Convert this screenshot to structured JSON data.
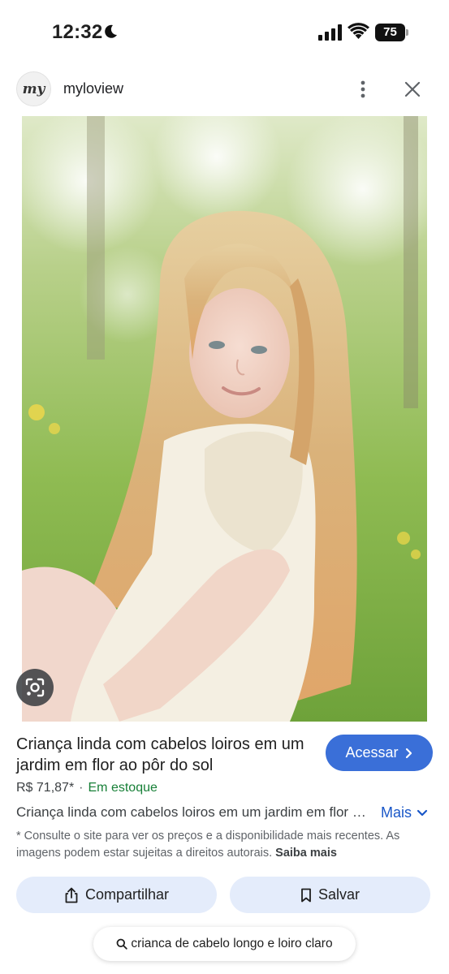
{
  "status_bar": {
    "time": "12:32",
    "battery": "75",
    "icons": [
      "moon-icon",
      "signal-icon",
      "wifi-icon",
      "battery-icon"
    ]
  },
  "header": {
    "site_avatar_text": "my",
    "site_name": "myloview",
    "icons": [
      "more-vert-icon",
      "close-icon"
    ]
  },
  "product": {
    "title": "Criança linda com cabelos loiros em um jardim em flor ao pôr do sol",
    "visit_label": "Acessar",
    "price": "R$ 71,87*",
    "separator": "·",
    "stock": "Em estoque",
    "description": "Criança linda com cabelos loiros em um jardim em flor ao pôr do sol",
    "more_label": "Mais",
    "disclaimer": "* Consulte o site para ver os preços e a disponibilidade mais recentes. As imagens podem estar sujeitas a direitos autorais.",
    "learn_more": "Saiba mais"
  },
  "actions": {
    "share_label": "Compartilhar",
    "save_label": "Salvar"
  },
  "search_chip": {
    "query": "crianca de cabelo longo e loiro claro"
  },
  "colors": {
    "accent_blue": "#3a6fd8",
    "action_bg": "#e4ecfb",
    "stock_green": "#188038",
    "link_blue": "#1a57c8"
  }
}
